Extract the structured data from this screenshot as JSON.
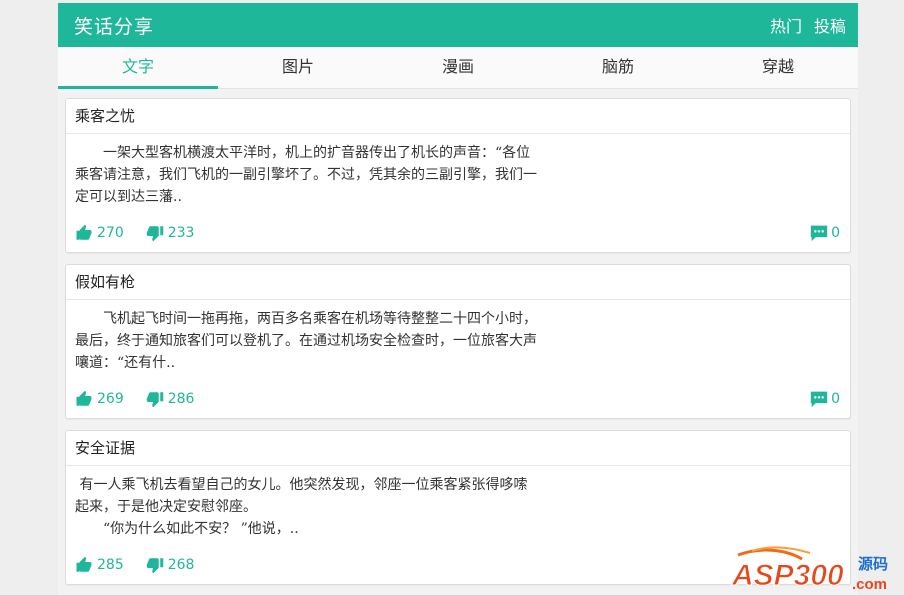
{
  "header": {
    "title": "笑话分享",
    "actions": [
      "热门",
      "投稿"
    ]
  },
  "tabs": [
    {
      "label": "文字",
      "active": true
    },
    {
      "label": "图片",
      "active": false
    },
    {
      "label": "漫画",
      "active": false
    },
    {
      "label": "脑筋",
      "active": false
    },
    {
      "label": "穿越",
      "active": false
    }
  ],
  "posts": [
    {
      "title": "乘客之忧",
      "body": "　　一架大型客机横渡太平洋时，机上的扩音器传出了机长的声音：“各位乘客请注意，我们飞机的一副引擎坏了。不过，凭其余的三副引擎，我们一定可以到达三藩..",
      "likes": "270",
      "dislikes": "233",
      "comments": "0"
    },
    {
      "title": "假如有枪",
      "body": "　　飞机起飞时间一拖再拖，两百多名乘客在机场等待整整二十四个小时，最后，终于通知旅客们可以登机了。在通过机场安全检查时，一位旅客大声嚷道：“还有什..",
      "likes": "269",
      "dislikes": "286",
      "comments": "0"
    },
    {
      "title": "安全证据",
      "body": " 有一人乘飞机去看望自己的女儿。他突然发现，邻座一位乘客紧张得哆嗦起来，于是他决定安慰邻座。\n　　“你为什么如此不安？ ”他说，..",
      "likes": "285",
      "dislikes": "268",
      "comments": ""
    }
  ],
  "watermark": {
    "brand": "ASP300",
    "suffix": "源码",
    "domain": ".com"
  },
  "colors": {
    "accent": "#1fb79a"
  }
}
